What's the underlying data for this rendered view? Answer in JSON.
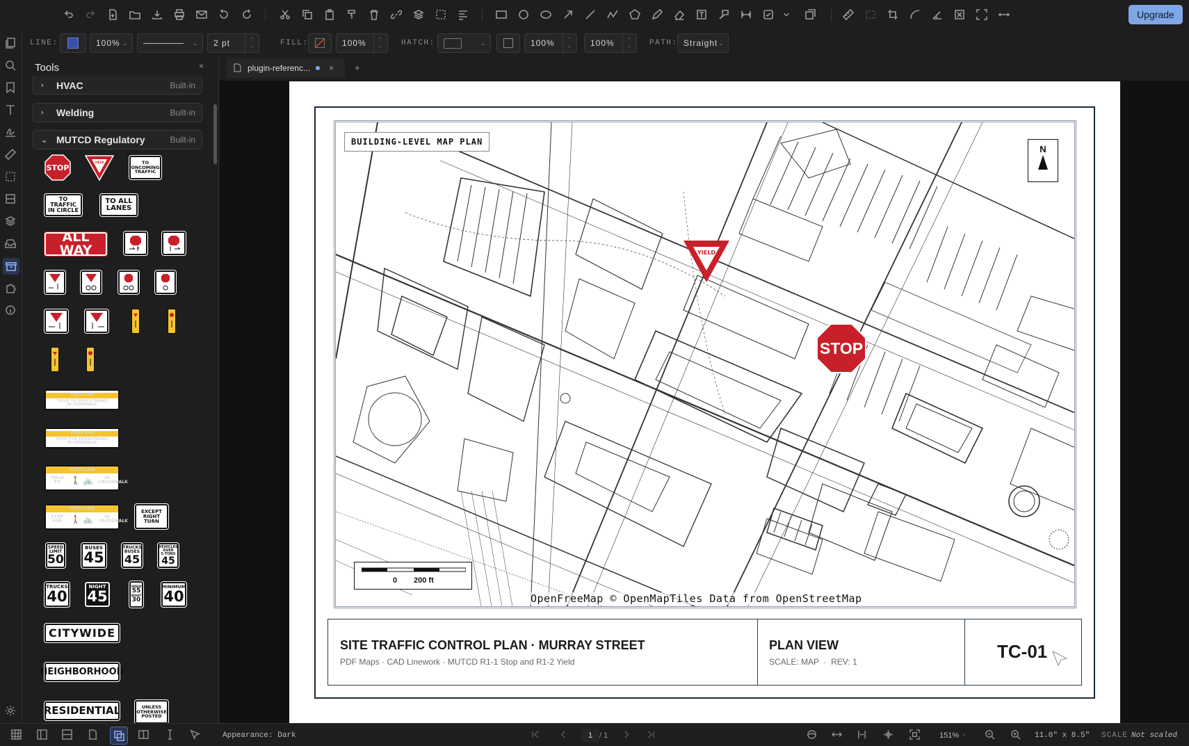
{
  "topbar": {
    "upgrade_label": "Upgrade",
    "icons": [
      "undo-icon",
      "redo-icon",
      "new-file-icon",
      "open-folder-icon",
      "download-icon",
      "print-icon",
      "email-icon",
      "rotate-left-icon",
      "rotate-right-icon",
      "cut-icon",
      "copy-icon",
      "paste-icon",
      "format-painter-icon",
      "delete-icon",
      "link-icon",
      "layers-icon",
      "select-icon",
      "align-icon",
      "rectangle-icon",
      "circle-icon",
      "ellipse-icon",
      "arrow-icon",
      "line-icon",
      "polyline-icon",
      "polygon-icon",
      "pen-icon",
      "eraser-icon",
      "text-box-icon",
      "callout-icon",
      "dimension-icon",
      "checkbox-icon",
      "dropdown-icon",
      "stamp-icon",
      "measure-icon",
      "area-icon",
      "crop-icon",
      "curve-icon",
      "angle-icon",
      "clear-icon",
      "fullscreen-icon",
      "distance-icon"
    ]
  },
  "propbar": {
    "line_label": "LINE:",
    "line_color": "#3b4fa8",
    "line_opacity": "100%",
    "line_width": "2 pt",
    "fill_label": "FILL:",
    "fill_opacity": "100%",
    "hatch_label": "HATCH:",
    "opacity_a": "100%",
    "opacity_b": "100%",
    "path_label": "PATH:",
    "path_value": "Straight"
  },
  "panel": {
    "title": "Tools",
    "close": "×",
    "categories": [
      {
        "name": "HVAC",
        "tag": "Built-in",
        "expanded": false
      },
      {
        "name": "Welding",
        "tag": "Built-in",
        "expanded": false
      },
      {
        "name": "MUTCD Regulatory",
        "tag": "Built-in",
        "expanded": true
      }
    ],
    "signs": {
      "stop": "STOP",
      "yield": "YIELD",
      "oncoming_1": "TO",
      "oncoming_2": "ONCOMING",
      "oncoming_3": "TRAFFIC",
      "circle_1": "TO TRAFFIC",
      "circle_2": "IN CIRCLE",
      "lanes_1": "TO ALL",
      "lanes_2": "LANES",
      "allway": "ALL WAY",
      "state_law": "STATE LAW",
      "yield_ped_1": "YIELD TO PEDESTRIANS",
      "yield_ped_2": "IN CROSSWALK",
      "stop_ped_1": "STOP FOR PEDESTRIANS",
      "stop_ped_2": "IN CROSSWALK",
      "yield_to": "YIELD TO",
      "stop_for": "STOP FOR",
      "in_crosswalk": "IN CROSSWALK",
      "except_1": "EXCEPT",
      "except_2": "RIGHT",
      "except_3": "TURN",
      "speed_1": "SPEED",
      "speed_2": "LIMIT",
      "speed_val": "50",
      "buses": "BUSES",
      "buses_val": "45",
      "trucks_buses_1": "TRUCKS",
      "trucks_buses_2": "BUSES",
      "trucks_buses_val": "45",
      "vehicles_1": "VEHICLES",
      "vehicles_2": "OVER",
      "vehicles_3": "5 TONS",
      "vehicles_val": "45",
      "trucks": "TRUCKS",
      "trucks_val": "40",
      "night": "NIGHT",
      "night_val": "45",
      "minimum": "MINIMUM",
      "minimum_val": "40",
      "citywide": "CITYWIDE",
      "neighborhood": "NEIGHBORHOOD",
      "residential": "RESIDENTIAL",
      "unless_1": "UNLESS",
      "unless_2": "OTHERWISE",
      "unless_3": "POSTED"
    }
  },
  "tabs": [
    {
      "label": "plugin-referenc...",
      "modified": true
    }
  ],
  "tab_add": "+",
  "tab_close": "×",
  "document": {
    "map_title": "BUILDING-LEVEL MAP PLAN",
    "north": "N",
    "scale_zero": "0",
    "scale_dist": "200 ft",
    "attribution": "OpenFreeMap © OpenMapTiles Data from OpenStreetMap",
    "map_stop": "STOP",
    "map_yield": "YIELD",
    "title": "SITE TRAFFIC CONTROL PLAN · MURRAY STREET",
    "subtitle": "PDF Maps · CAD Linework · MUTCD R1-1 Stop and R1-2 Yield",
    "view": "PLAN VIEW",
    "scale_info": "SCALE: MAP  ·  REV: 1",
    "sheet_id": "TC-01"
  },
  "statusbar": {
    "appearance": "Appearance: Dark",
    "page_current": "1",
    "page_total": "/ 1",
    "zoom": "151%",
    "paper": "11.0\" x 8.5\"",
    "scale_label": "SCALE",
    "scale_value": "Not scaled"
  }
}
